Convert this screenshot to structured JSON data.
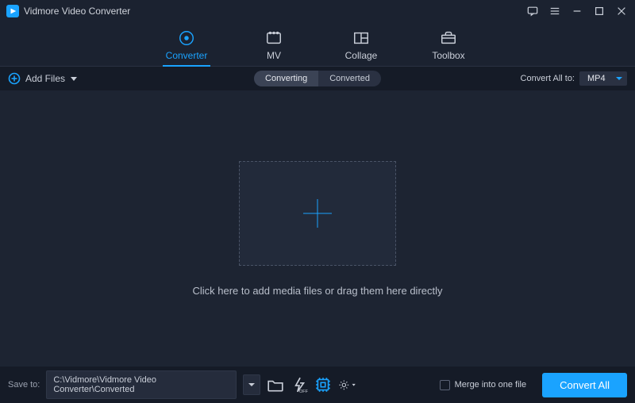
{
  "titlebar": {
    "appName": "Vidmore Video Converter"
  },
  "tabs": {
    "converter": "Converter",
    "mv": "MV",
    "collage": "Collage",
    "toolbox": "Toolbox"
  },
  "subbar": {
    "addFiles": "Add Files",
    "converting": "Converting",
    "converted": "Converted",
    "convertAllToLabel": "Convert All to:",
    "selectedFormat": "MP4"
  },
  "main": {
    "hint": "Click here to add media files or drag them here directly"
  },
  "bottombar": {
    "saveToLabel": "Save to:",
    "savePath": "C:\\Vidmore\\Vidmore Video Converter\\Converted",
    "mergeLabel": "Merge into one file",
    "convertAll": "Convert All"
  }
}
